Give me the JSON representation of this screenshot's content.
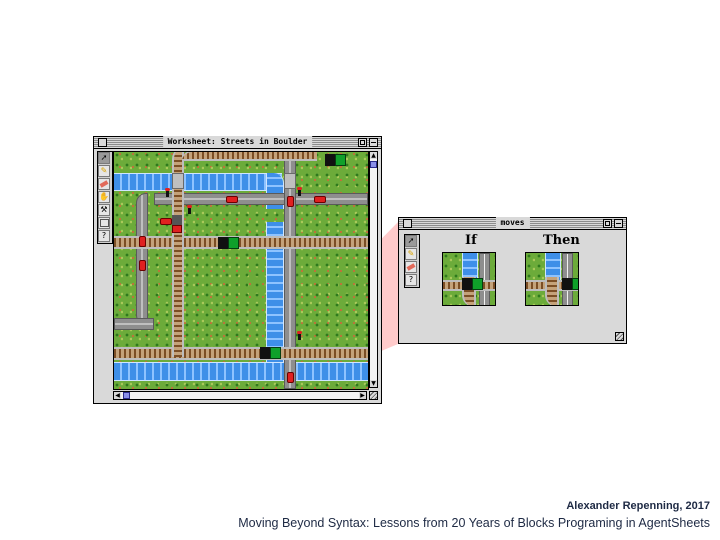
{
  "worksheet": {
    "title": "Worksheet: Streets in Boulder",
    "tools": [
      "arrow-tool",
      "pencil-tool",
      "eraser-tool",
      "hand-tool",
      "hammer-tool",
      "blank-tool",
      "help-tool"
    ],
    "help_label": "?",
    "scroll_up": "▲",
    "scroll_down": "▼",
    "scroll_left": "◀",
    "scroll_right": "▶"
  },
  "moves": {
    "title": "moves",
    "help_label": "?",
    "if_label": "If",
    "then_label": "Then"
  },
  "caption": {
    "author": "Alexander Repenning, 2017",
    "talk": "Moving Beyond Syntax: Lessons from 20 Years of Blocks Programing in AgentSheets"
  },
  "colors": {
    "grass": "#6cab3a",
    "water": "#3e8fe8",
    "road": "#8e8e8e",
    "train": "#0fa02a",
    "car": "#e02020",
    "beam": "#ff8c8c",
    "caption": "#1e2a44"
  }
}
